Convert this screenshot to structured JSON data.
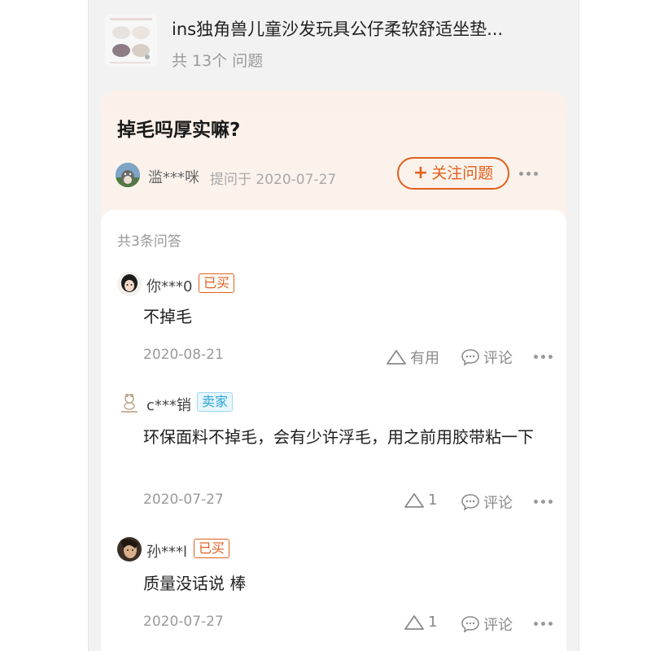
{
  "product": {
    "title": "ins独角兽儿童沙发玩具公仔柔软舒适坐垫...",
    "question_count": "共 13个 问题"
  },
  "question": {
    "title": "掉毛吗厚实嘛?",
    "asker_name": "滥***咪",
    "asked_time": "提问于 2020-07-27",
    "follow_label": "关注问题"
  },
  "answers_header": "共3条问答",
  "answers": [
    {
      "user": "你***0",
      "badge": "已买",
      "badge_type": "bought",
      "text": "不掉毛",
      "date": "2020-08-21",
      "like_label": "有用",
      "comment_label": "评论"
    },
    {
      "user": "c***销",
      "badge": "卖家",
      "badge_type": "seller",
      "text": "环保面料不掉毛，会有少许浮毛，用之前用胶带粘一下",
      "date": "2020-07-27",
      "like_label": "1",
      "comment_label": "评论"
    },
    {
      "user": "孙***l",
      "badge": "已买",
      "badge_type": "bought",
      "text": "质量没话说 棒",
      "date": "2020-07-27",
      "like_label": "1",
      "comment_label": "评论"
    }
  ],
  "icons": {
    "like": "thumb-triangle-icon",
    "comment": "speech-bubble-icon",
    "more": "more-dots-icon",
    "follow": "plus-icon"
  },
  "colors": {
    "accent": "#e2601d",
    "seller": "#2aa6d6",
    "card_bg": "#fbf1ea"
  }
}
